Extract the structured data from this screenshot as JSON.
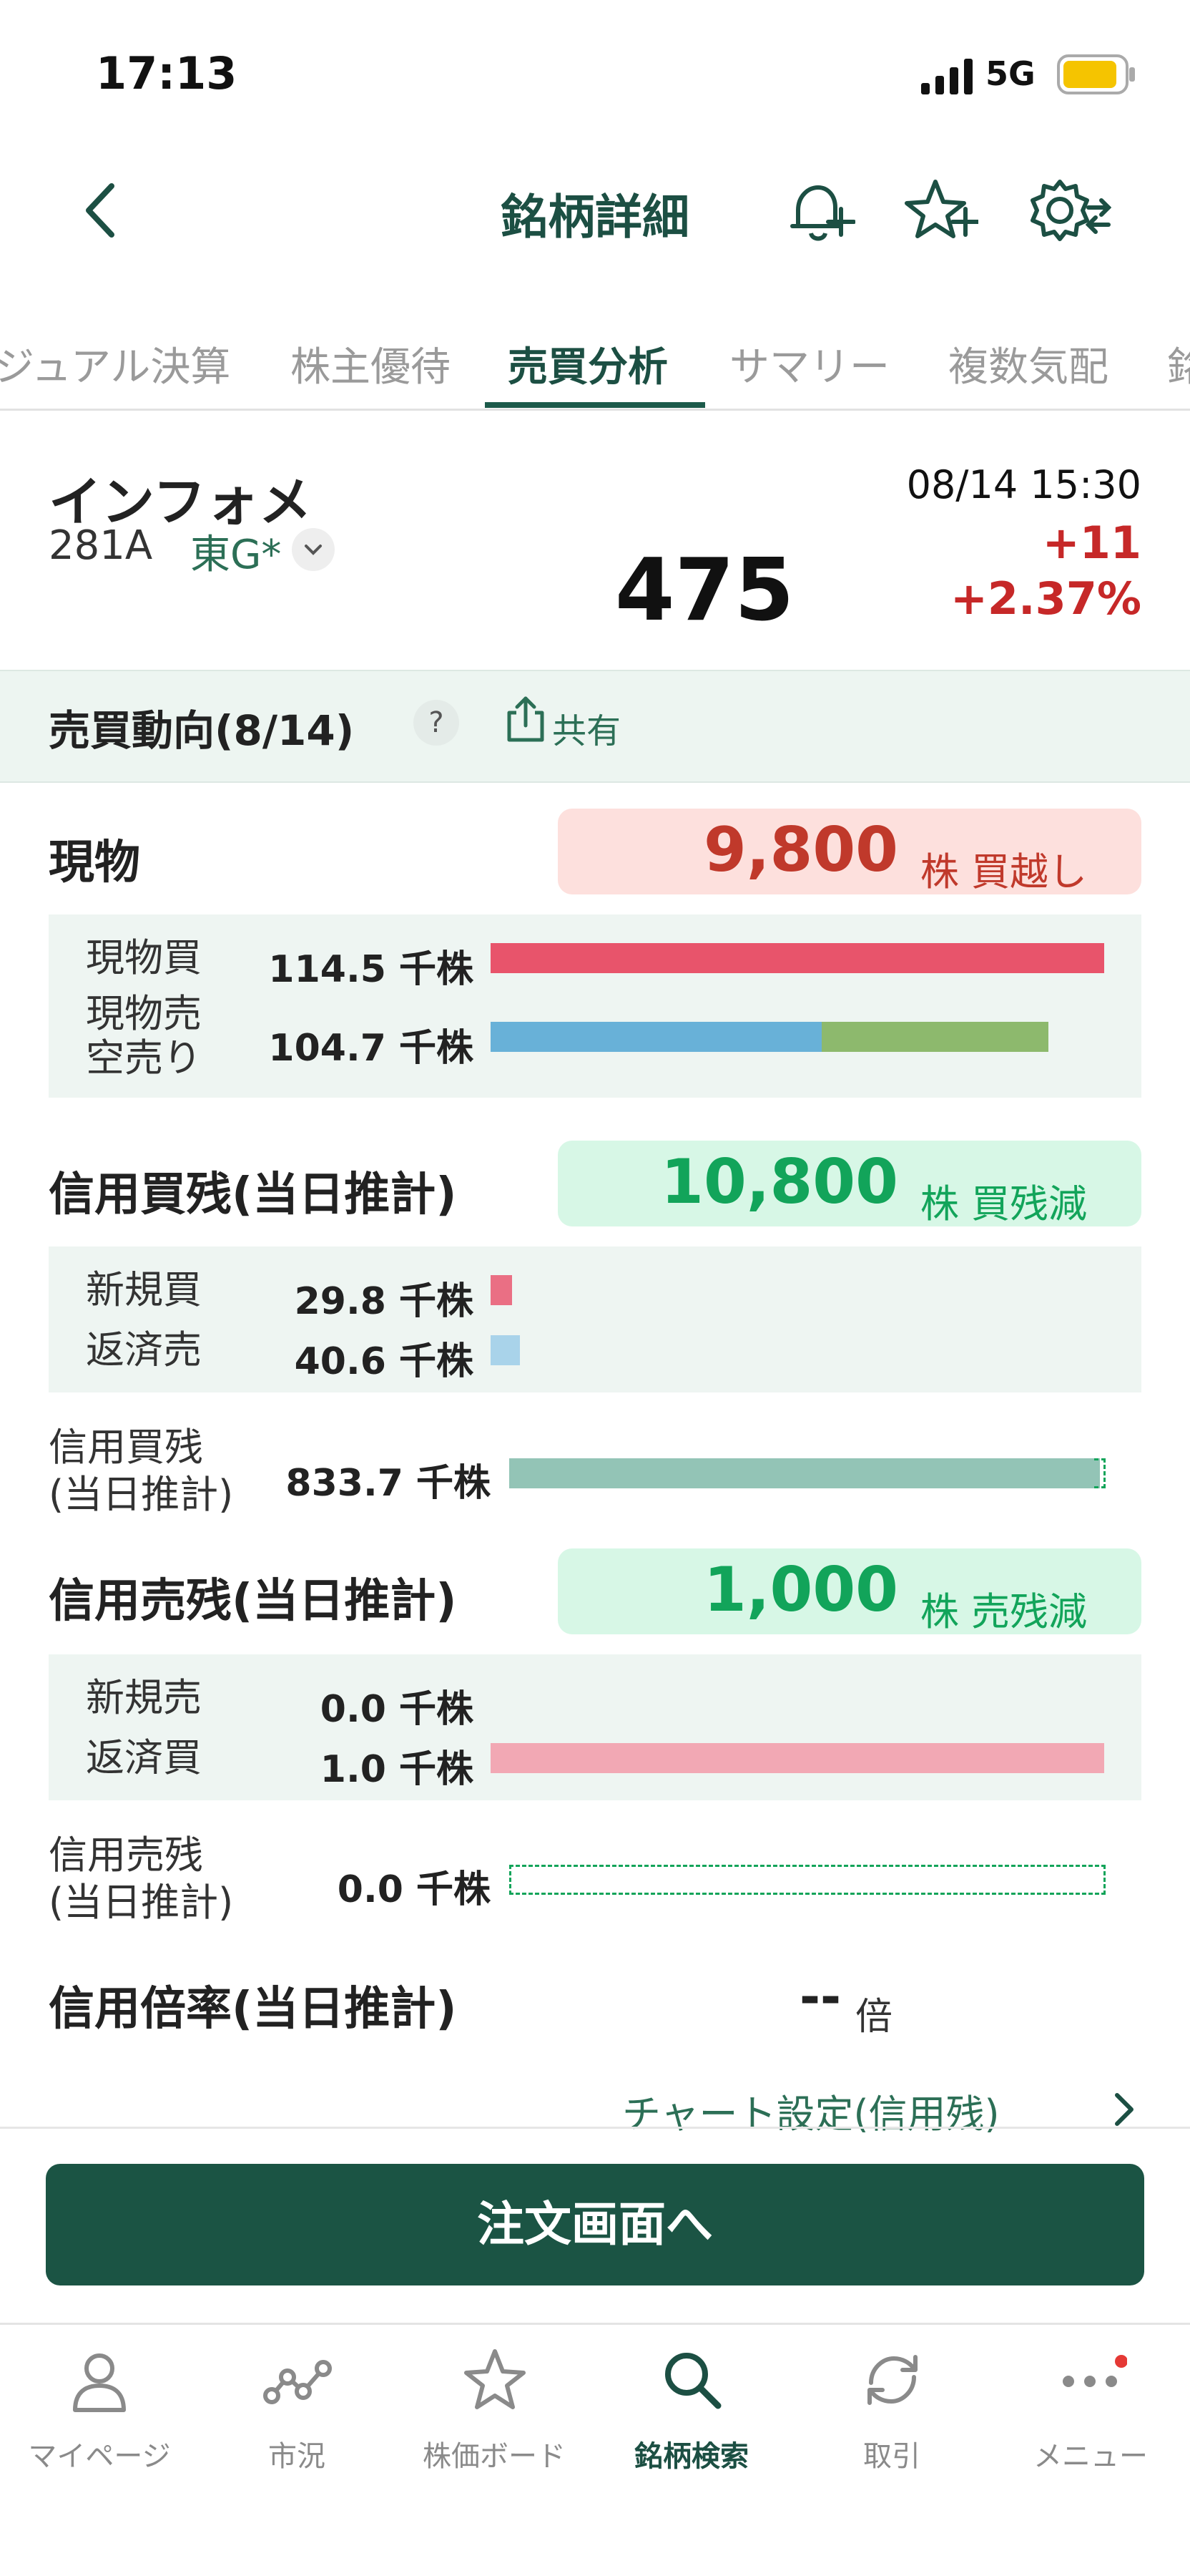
{
  "status_bar": {
    "time": "17:13",
    "network": "5G"
  },
  "header": {
    "title": "銘柄詳細"
  },
  "tabs": [
    {
      "label": "ジュアル決算",
      "active": false
    },
    {
      "label": "株主優待",
      "active": false
    },
    {
      "label": "売買分析",
      "active": true
    },
    {
      "label": "サマリー",
      "active": false
    },
    {
      "label": "複数気配",
      "active": false
    },
    {
      "label": "銘",
      "active": false
    }
  ],
  "stock": {
    "name": "インフォメ",
    "code": "281A",
    "market": "東G*",
    "price": "475",
    "datetime": "08/14 15:30",
    "change": "+11",
    "change_pct": "+2.37%"
  },
  "section": {
    "title": "売買動向(8/14)",
    "help": "?",
    "share_label": "共有"
  },
  "genbutsu": {
    "title": "現物",
    "badge_value": "9,800",
    "badge_unit": "株 買越し",
    "buy_label": "現物買",
    "buy_value": "114.5 千株",
    "buy_fraction": 1.0,
    "sell_label": "現物売",
    "short_label": "空売り",
    "sell_value": "104.7 千株",
    "sell_fraction": 0.54,
    "short_fraction": 0.37
  },
  "margin_buy": {
    "title": "信用買残(当日推計)",
    "badge_value": "10,800",
    "badge_unit": "株 買残減",
    "new_label": "新規買",
    "new_value": "29.8 千株",
    "new_fraction": 0.035,
    "repay_label": "返済売",
    "repay_value": "40.6 千株",
    "repay_fraction": 0.048,
    "balance_label_1": "信用買残",
    "balance_label_2": "(当日推計)",
    "balance_value": "833.7 千株",
    "balance_fraction": 0.99
  },
  "margin_sell": {
    "title": "信用売残(当日推計)",
    "badge_value": "1,000",
    "badge_unit": "株 売残減",
    "new_label": "新規売",
    "new_value": "0.0 千株",
    "new_fraction": 0.0,
    "repay_label": "返済買",
    "repay_value": "1.0 千株",
    "repay_fraction": 1.0,
    "balance_label_1": "信用売残",
    "balance_label_2": "(当日推計)",
    "balance_value": "0.0 千株",
    "balance_fraction": 0.0
  },
  "ratio": {
    "title": "信用倍率(当日推計)",
    "value": "--",
    "unit": "倍"
  },
  "chart_link": "チャート設定(信用残)",
  "order_button": "注文画面へ",
  "tabbar": [
    {
      "label": "マイページ",
      "icon": "person-icon",
      "active": false
    },
    {
      "label": "市況",
      "icon": "market-icon",
      "active": false
    },
    {
      "label": "株価ボード",
      "icon": "star-icon",
      "active": false
    },
    {
      "label": "銘柄検索",
      "icon": "search-icon",
      "active": true
    },
    {
      "label": "取引",
      "icon": "refresh-icon",
      "active": false
    },
    {
      "label": "メニュー",
      "icon": "menu-dots-icon",
      "active": false
    }
  ],
  "colors": {
    "accent": "#1c4f43",
    "up_red": "#c62828",
    "buy_bar": "#e8546b",
    "sell_bar": "#68b1d8",
    "short_bar": "#8db96d",
    "balance_bar": "#93c4b6",
    "green_badge_text": "#12a45a"
  }
}
